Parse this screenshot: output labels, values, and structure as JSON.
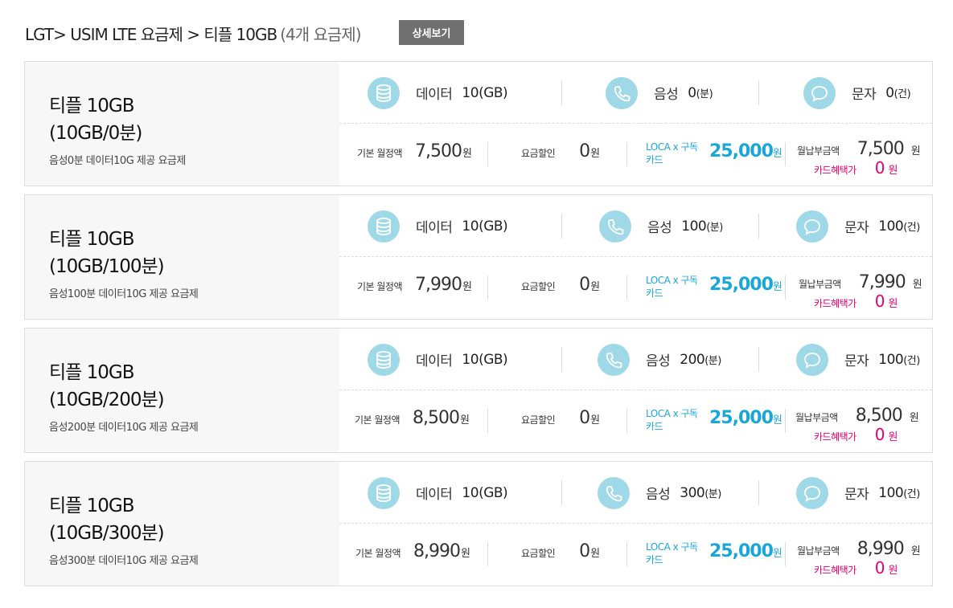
{
  "header": {
    "crumb": "LGT> USIM LTE 요금제 > 티플 10GB",
    "count": "(4개 요금제)",
    "detail_button": "상세보기"
  },
  "labels": {
    "data": "데이터",
    "voice": "음성",
    "sms": "문자",
    "base": "기본 월정액",
    "discount": "요금할인",
    "loca_line1": "LOCA x 구독",
    "loca_line2": "카드",
    "monthly": "월납부금액",
    "card_benefit": "카드혜택가",
    "won": "원",
    "unit_gb": "(GB)",
    "unit_min": "(분)",
    "unit_cnt": "(건)"
  },
  "plans": [
    {
      "name1": "티플 10GB",
      "name2": "(10GB/0분)",
      "desc": "음성0분 데이터10G 제공 요금제",
      "data": "10",
      "voice": "0",
      "sms": "0",
      "base": "7,500",
      "discount": "0",
      "loca": "25,000",
      "monthly": "7,500",
      "card": "0"
    },
    {
      "name1": "티플 10GB",
      "name2": "(10GB/100분)",
      "desc": "음성100분 데이터10G 제공 요금제",
      "data": "10",
      "voice": "100",
      "sms": "100",
      "base": "7,990",
      "discount": "0",
      "loca": "25,000",
      "monthly": "7,990",
      "card": "0"
    },
    {
      "name1": "티플 10GB",
      "name2": "(10GB/200분)",
      "desc": "음성200분 데이터10G 제공 요금제",
      "data": "10",
      "voice": "200",
      "sms": "100",
      "base": "8,500",
      "discount": "0",
      "loca": "25,000",
      "monthly": "8,500",
      "card": "0"
    },
    {
      "name1": "티플 10GB",
      "name2": "(10GB/300분)",
      "desc": "음성300분 데이터10G 제공 요금제",
      "data": "10",
      "voice": "300",
      "sms": "100",
      "base": "8,990",
      "discount": "0",
      "loca": "25,000",
      "monthly": "8,990",
      "card": "0"
    }
  ],
  "colors": {
    "accent": "#1aa7d8",
    "icon_bg": "#9fd8e6",
    "pink": "#e6006f",
    "button": "#707070"
  }
}
